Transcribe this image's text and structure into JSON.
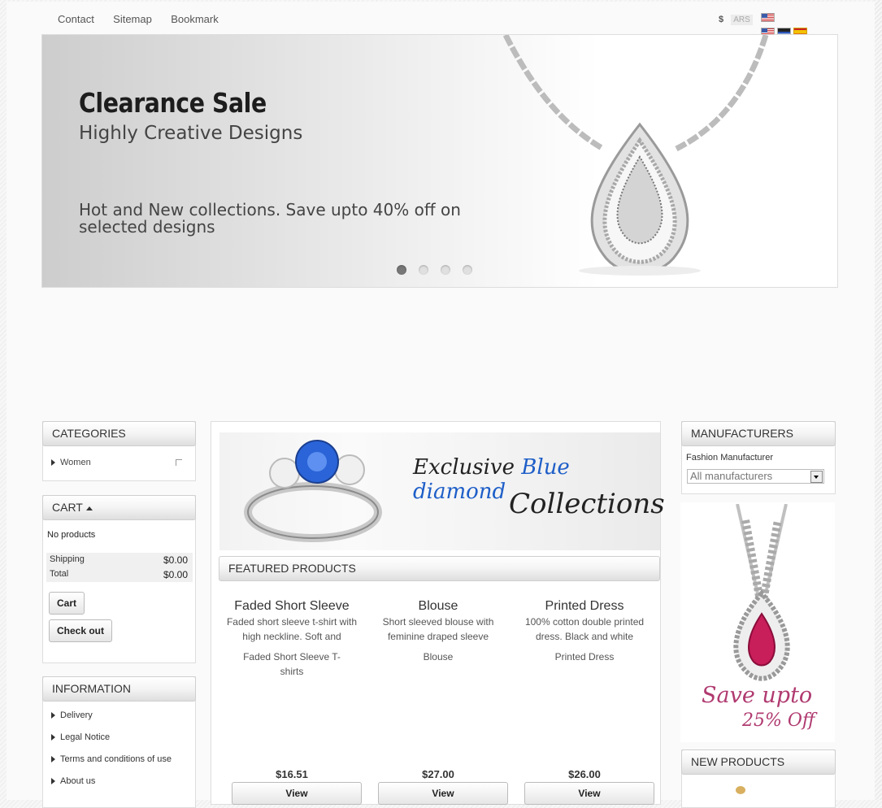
{
  "topnav": {
    "links": [
      "Contact",
      "Sitemap",
      "Bookmark"
    ]
  },
  "currency": {
    "symbol": "$",
    "code": "ARS"
  },
  "slider": {
    "title": "Clearance Sale",
    "subtitle": "Highly Creative Designs",
    "desc_line1": "Hot and New collections. Save upto 40% off on",
    "desc_line2": "selected designs",
    "active_dot": 1,
    "dot_count": 4
  },
  "categories": {
    "title": "CATEGORIES",
    "items": [
      "Women"
    ]
  },
  "cart": {
    "title": "CART",
    "empty_text": "No products",
    "shipping_label": "Shipping",
    "shipping_value": "$0.00",
    "total_label": "Total",
    "total_value": "$0.00",
    "cart_button": "Cart",
    "checkout_button": "Check out"
  },
  "information": {
    "title": "INFORMATION",
    "items": [
      "Delivery",
      "Legal Notice",
      "Terms and conditions of use",
      "About us"
    ]
  },
  "banner": {
    "line1_a": "Exclusive ",
    "line1_b": "Blue diamond",
    "line2": "Collections"
  },
  "featured": {
    "title": "FEATURED PRODUCTS",
    "products": [
      {
        "name": "Faded Short Sleeve",
        "desc": "Faded short sleeve t-shirt with high neckline. Soft and",
        "sub": "Faded Short Sleeve T-shirts",
        "price": "$16.51",
        "button": "View"
      },
      {
        "name": "Blouse",
        "desc": "Short sleeved blouse with feminine draped sleeve",
        "sub": "Blouse",
        "price": "$27.00",
        "button": "View"
      },
      {
        "name": "Printed Dress",
        "desc": "100% cotton double printed dress. Black and white",
        "sub": "Printed Dress",
        "price": "$26.00",
        "button": "View"
      }
    ]
  },
  "manufacturers": {
    "title": "MANUFACTURERS",
    "item": "Fashion Manufacturer",
    "select_value": "All manufacturers"
  },
  "promo": {
    "line1": "Save upto",
    "line2": "25% Off"
  },
  "new_products": {
    "title": "NEW PRODUCTS"
  }
}
